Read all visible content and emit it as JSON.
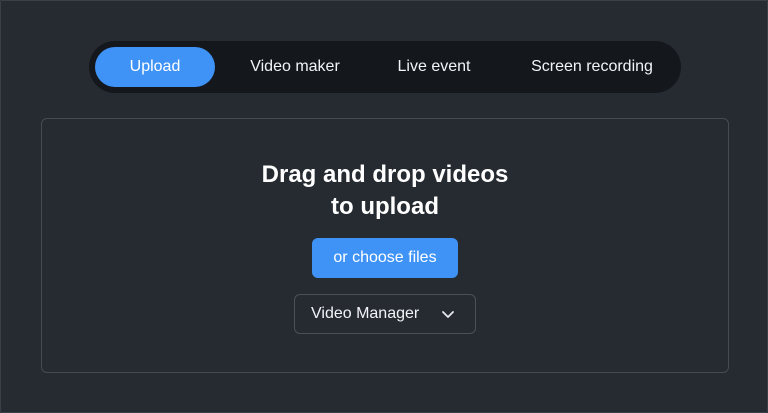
{
  "tabs": [
    {
      "label": "Upload",
      "active": true
    },
    {
      "label": "Video maker",
      "active": false
    },
    {
      "label": "Live event",
      "active": false
    },
    {
      "label": "Screen recording",
      "active": false
    }
  ],
  "dropzone": {
    "headline_line1": "Drag and drop videos",
    "headline_line2": "to upload",
    "choose_label": "or choose files",
    "destination": {
      "selected": "Video Manager",
      "icon": "chevron-down-icon"
    }
  },
  "colors": {
    "background": "#262b32",
    "tabbar": "#14171c",
    "accent": "#3f93f7",
    "border": "#454b54"
  }
}
